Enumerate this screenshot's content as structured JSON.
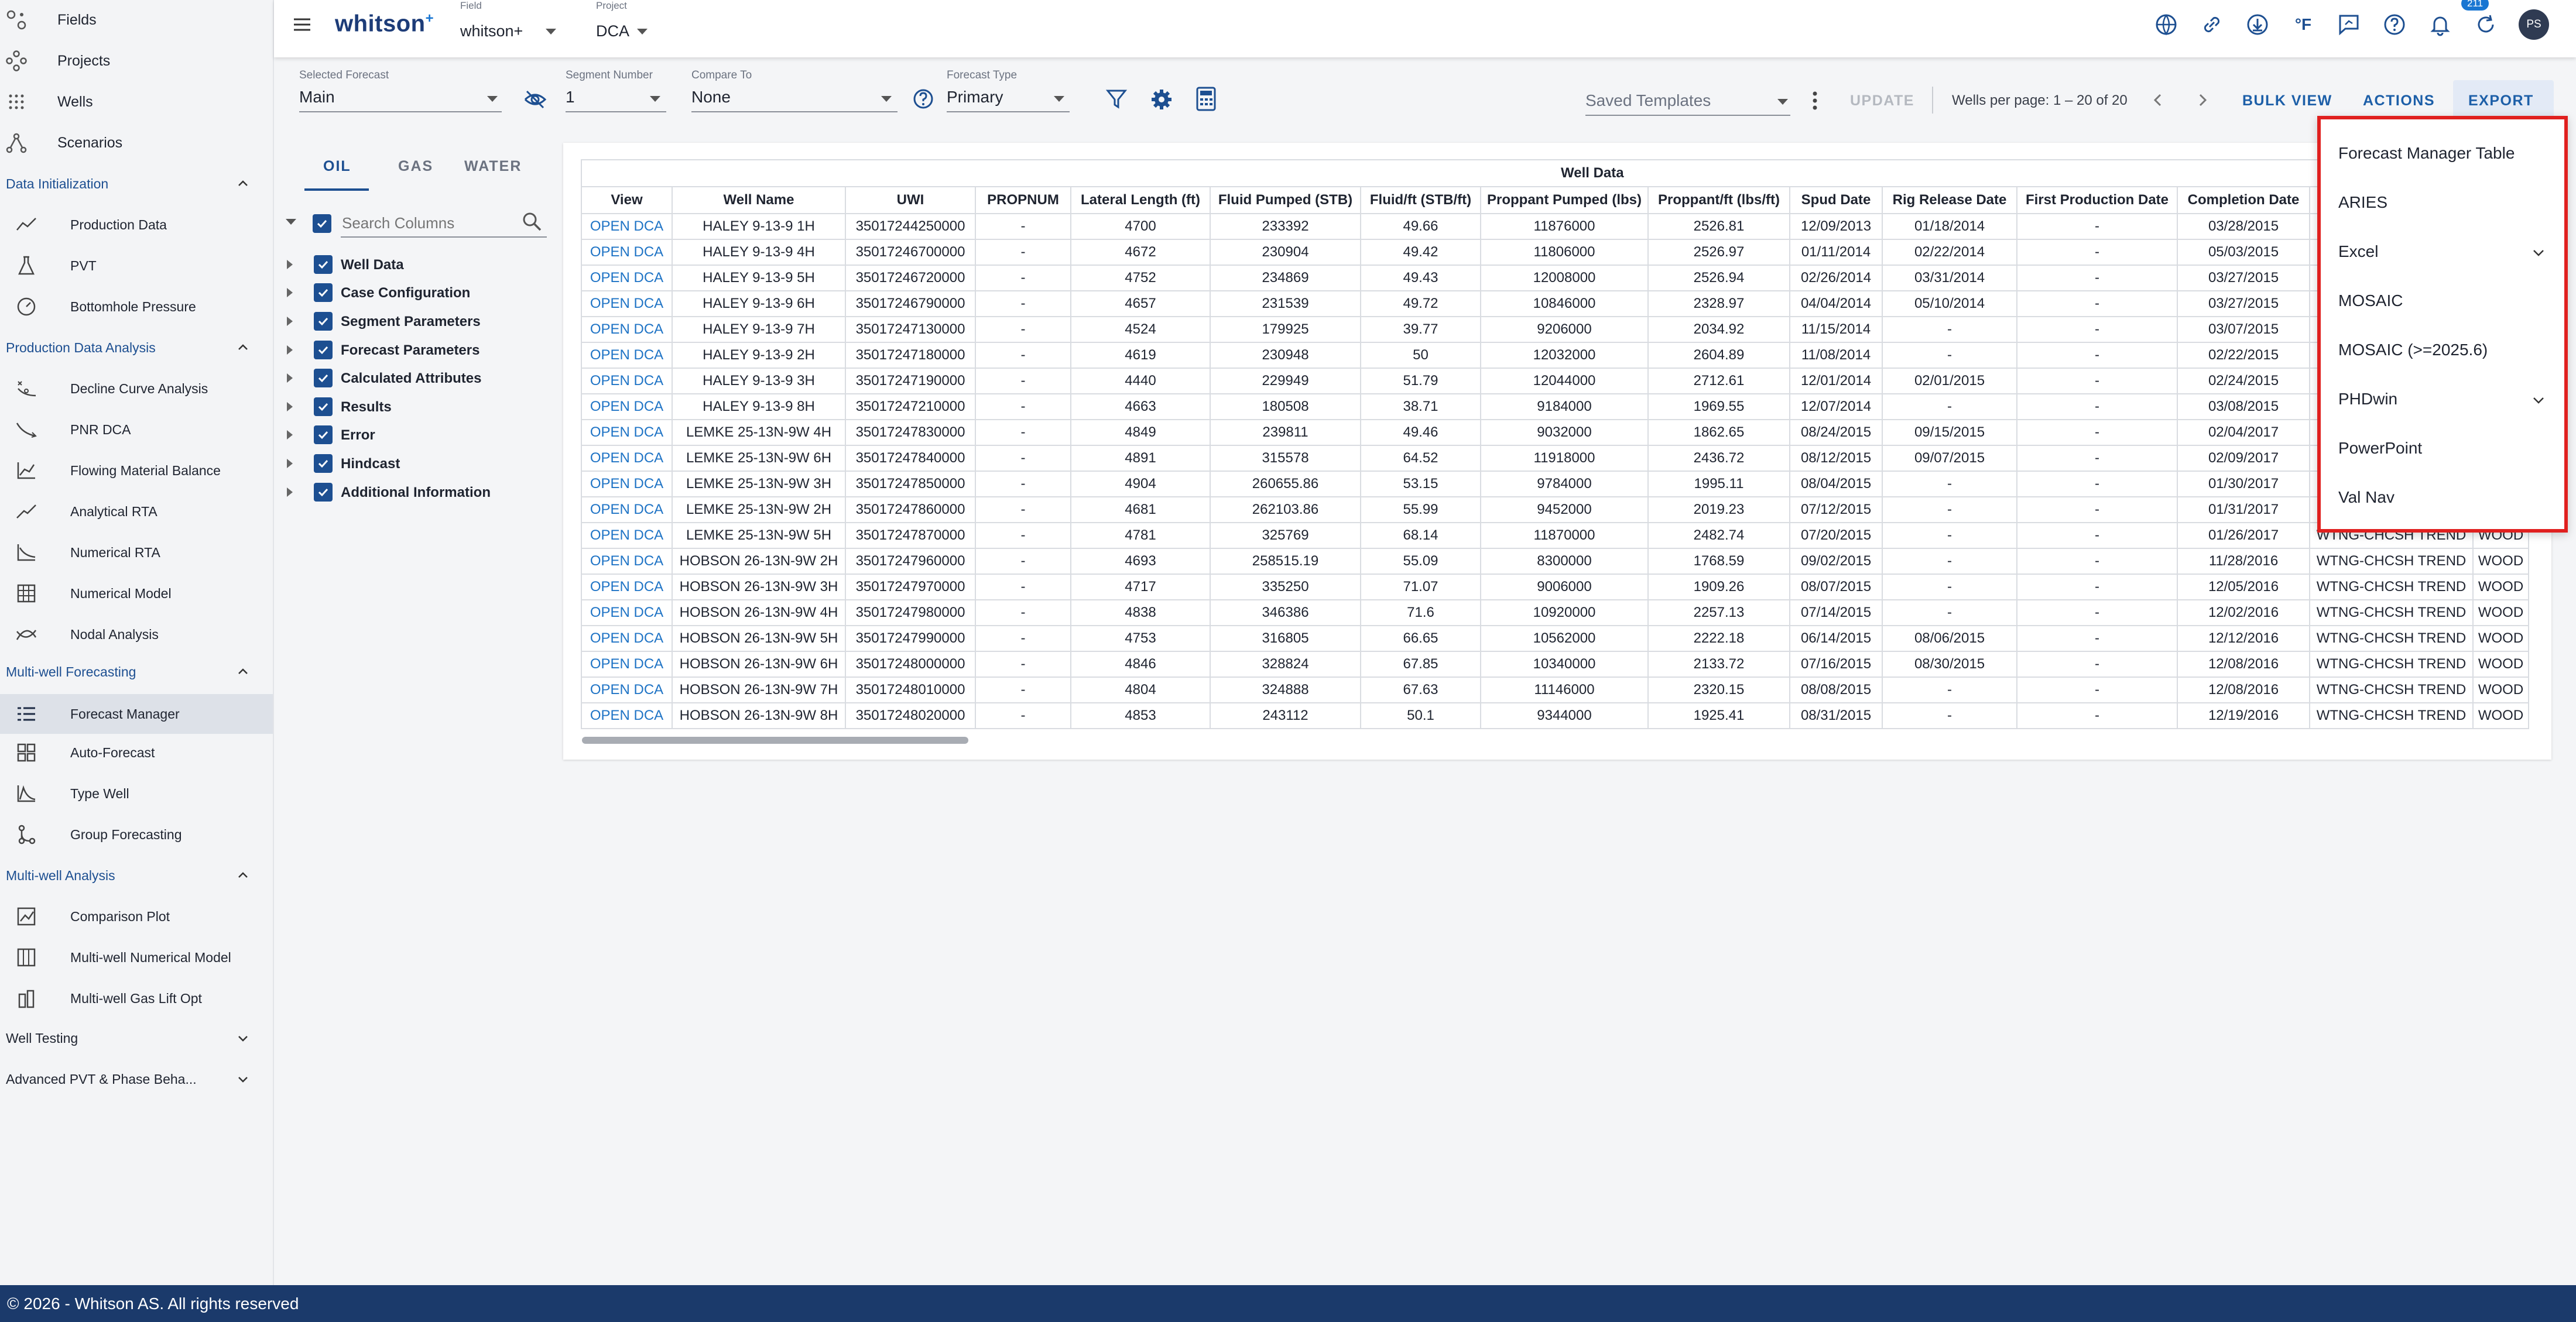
{
  "sidebar": {
    "top_items": [
      {
        "label": "Fields",
        "icon": "fields-icon"
      },
      {
        "label": "Projects",
        "icon": "projects-icon"
      },
      {
        "label": "Wells",
        "icon": "wells-icon"
      },
      {
        "label": "Scenarios",
        "icon": "scenarios-icon"
      }
    ],
    "sections": {
      "data_init": {
        "title": "Data Initialization",
        "items": [
          "Production Data",
          "PVT",
          "Bottomhole Pressure"
        ]
      },
      "prod_analysis": {
        "title": "Production Data Analysis",
        "items": [
          "Decline Curve Analysis",
          "PNR DCA",
          "Flowing Material Balance",
          "Analytical RTA",
          "Numerical RTA",
          "Numerical Model",
          "Nodal Analysis"
        ]
      },
      "mw_forecast": {
        "title": "Multi-well Forecasting",
        "items": [
          "Forecast Manager",
          "Auto-Forecast",
          "Type Well",
          "Group Forecasting"
        ]
      },
      "mw_analysis": {
        "title": "Multi-well Analysis",
        "items": [
          "Comparison Plot",
          "Multi-well Numerical Model",
          "Multi-well Gas Lift Opt"
        ]
      },
      "well_testing": {
        "title": "Well Testing"
      },
      "adv_pvt": {
        "title": "Advanced PVT & Phase Beha..."
      }
    }
  },
  "header": {
    "logo": "whitson",
    "logo_sup": "+",
    "field_label": "Field",
    "field_value": "whitson+",
    "project_label": "Project",
    "project_value": "DCA",
    "notifications_count": "211",
    "avatar": "PS",
    "temp_unit": "°F"
  },
  "toolbar": {
    "selected_forecast_label": "Selected Forecast",
    "selected_forecast_value": "Main",
    "segment_number_label": "Segment Number",
    "segment_number_value": "1",
    "compare_to_label": "Compare To",
    "compare_to_value": "None",
    "forecast_type_label": "Forecast Type",
    "forecast_type_value": "Primary",
    "saved_templates_placeholder": "Saved Templates",
    "update_label": "UPDATE",
    "pagination": "Wells per page: 1 – 20 of 20",
    "bulk_view_label": "BULK VIEW",
    "actions_label": "ACTIONS",
    "export_label": "EXPORT"
  },
  "column_panel": {
    "tabs": [
      "OIL",
      "GAS",
      "WATER"
    ],
    "search_placeholder": "Search Columns",
    "groups": [
      "Well Data",
      "Case Configuration",
      "Segment Parameters",
      "Forecast Parameters",
      "Calculated Attributes",
      "Results",
      "Error",
      "Hindcast",
      "Additional Information"
    ]
  },
  "table": {
    "group_header": "Well Data",
    "columns": [
      "View",
      "Well Name",
      "UWI",
      "PROPNUM",
      "Lateral Length (ft)",
      "Fluid Pumped (STB)",
      "Fluid/ft (STB/ft)",
      "Proppant Pumped (lbs)",
      "Proppant/ft (lbs/ft)",
      "Spud Date",
      "Rig Release Date",
      "First Production Date",
      "Completion Date",
      "",
      ""
    ],
    "rows": [
      [
        "OPEN DCA",
        "HALEY 9-13-9 1H",
        "35017244250000",
        "-",
        "4700",
        "233392",
        "49.66",
        "11876000",
        "2526.81",
        "12/09/2013",
        "01/18/2014",
        "-",
        "03/28/2015",
        "",
        ""
      ],
      [
        "OPEN DCA",
        "HALEY 9-13-9 4H",
        "35017246700000",
        "-",
        "4672",
        "230904",
        "49.42",
        "11806000",
        "2526.97",
        "01/11/2014",
        "02/22/2014",
        "-",
        "05/03/2015",
        "",
        ""
      ],
      [
        "OPEN DCA",
        "HALEY 9-13-9 5H",
        "35017246720000",
        "-",
        "4752",
        "234869",
        "49.43",
        "12008000",
        "2526.94",
        "02/26/2014",
        "03/31/2014",
        "-",
        "03/27/2015",
        "",
        ""
      ],
      [
        "OPEN DCA",
        "HALEY 9-13-9 6H",
        "35017246790000",
        "-",
        "4657",
        "231539",
        "49.72",
        "10846000",
        "2328.97",
        "04/04/2014",
        "05/10/2014",
        "-",
        "03/27/2015",
        "",
        ""
      ],
      [
        "OPEN DCA",
        "HALEY 9-13-9 7H",
        "35017247130000",
        "-",
        "4524",
        "179925",
        "39.77",
        "9206000",
        "2034.92",
        "11/15/2014",
        "-",
        "-",
        "03/07/2015",
        "",
        ""
      ],
      [
        "OPEN DCA",
        "HALEY 9-13-9 2H",
        "35017247180000",
        "-",
        "4619",
        "230948",
        "50",
        "12032000",
        "2604.89",
        "11/08/2014",
        "-",
        "-",
        "02/22/2015",
        "",
        ""
      ],
      [
        "OPEN DCA",
        "HALEY 9-13-9 3H",
        "35017247190000",
        "-",
        "4440",
        "229949",
        "51.79",
        "12044000",
        "2712.61",
        "12/01/2014",
        "02/01/2015",
        "-",
        "02/24/2015",
        "",
        ""
      ],
      [
        "OPEN DCA",
        "HALEY 9-13-9 8H",
        "35017247210000",
        "-",
        "4663",
        "180508",
        "38.71",
        "9184000",
        "1969.55",
        "12/07/2014",
        "-",
        "-",
        "03/08/2015",
        "",
        ""
      ],
      [
        "OPEN DCA",
        "LEMKE 25-13N-9W 4H",
        "35017247830000",
        "-",
        "4849",
        "239811",
        "49.46",
        "9032000",
        "1862.65",
        "08/24/2015",
        "09/15/2015",
        "-",
        "02/04/2017",
        "",
        ""
      ],
      [
        "OPEN DCA",
        "LEMKE 25-13N-9W 6H",
        "35017247840000",
        "-",
        "4891",
        "315578",
        "64.52",
        "11918000",
        "2436.72",
        "08/12/2015",
        "09/07/2015",
        "-",
        "02/09/2017",
        "",
        ""
      ],
      [
        "OPEN DCA",
        "LEMKE 25-13N-9W 3H",
        "35017247850000",
        "-",
        "4904",
        "260655.86",
        "53.15",
        "9784000",
        "1995.11",
        "08/04/2015",
        "-",
        "-",
        "01/30/2017",
        "",
        ""
      ],
      [
        "OPEN DCA",
        "LEMKE 25-13N-9W 2H",
        "35017247860000",
        "-",
        "4681",
        "262103.86",
        "55.99",
        "9452000",
        "2019.23",
        "07/12/2015",
        "-",
        "-",
        "01/31/2017",
        "",
        ""
      ],
      [
        "OPEN DCA",
        "LEMKE 25-13N-9W 5H",
        "35017247870000",
        "-",
        "4781",
        "325769",
        "68.14",
        "11870000",
        "2482.74",
        "07/20/2015",
        "-",
        "-",
        "01/26/2017",
        "WTNG-CHCSH TREND",
        "WOOD"
      ],
      [
        "OPEN DCA",
        "HOBSON 26-13N-9W 2H",
        "35017247960000",
        "-",
        "4693",
        "258515.19",
        "55.09",
        "8300000",
        "1768.59",
        "09/02/2015",
        "-",
        "-",
        "11/28/2016",
        "WTNG-CHCSH TREND",
        "WOOD"
      ],
      [
        "OPEN DCA",
        "HOBSON 26-13N-9W 3H",
        "35017247970000",
        "-",
        "4717",
        "335250",
        "71.07",
        "9006000",
        "1909.26",
        "08/07/2015",
        "-",
        "-",
        "12/05/2016",
        "WTNG-CHCSH TREND",
        "WOOD"
      ],
      [
        "OPEN DCA",
        "HOBSON 26-13N-9W 4H",
        "35017247980000",
        "-",
        "4838",
        "346386",
        "71.6",
        "10920000",
        "2257.13",
        "07/14/2015",
        "-",
        "-",
        "12/02/2016",
        "WTNG-CHCSH TREND",
        "WOOD"
      ],
      [
        "OPEN DCA",
        "HOBSON 26-13N-9W 5H",
        "35017247990000",
        "-",
        "4753",
        "316805",
        "66.65",
        "10562000",
        "2222.18",
        "06/14/2015",
        "08/06/2015",
        "-",
        "12/12/2016",
        "WTNG-CHCSH TREND",
        "WOOD"
      ],
      [
        "OPEN DCA",
        "HOBSON 26-13N-9W 6H",
        "35017248000000",
        "-",
        "4846",
        "328824",
        "67.85",
        "10340000",
        "2133.72",
        "07/16/2015",
        "08/30/2015",
        "-",
        "12/08/2016",
        "WTNG-CHCSH TREND",
        "WOOD"
      ],
      [
        "OPEN DCA",
        "HOBSON 26-13N-9W 7H",
        "35017248010000",
        "-",
        "4804",
        "324888",
        "67.63",
        "11146000",
        "2320.15",
        "08/08/2015",
        "-",
        "-",
        "12/08/2016",
        "WTNG-CHCSH TREND",
        "WOOD"
      ],
      [
        "OPEN DCA",
        "HOBSON 26-13N-9W 8H",
        "35017248020000",
        "-",
        "4853",
        "243112",
        "50.1",
        "9344000",
        "1925.41",
        "08/31/2015",
        "-",
        "-",
        "12/19/2016",
        "WTNG-CHCSH TREND",
        "WOOD"
      ]
    ]
  },
  "export_menu": {
    "items": [
      {
        "label": "Forecast Manager Table",
        "submenu": false
      },
      {
        "label": "ARIES",
        "submenu": false
      },
      {
        "label": "Excel",
        "submenu": true
      },
      {
        "label": "MOSAIC",
        "submenu": false
      },
      {
        "label": "MOSAIC (>=2025.6)",
        "submenu": false
      },
      {
        "label": "PHDwin",
        "submenu": true
      },
      {
        "label": "PowerPoint",
        "submenu": false
      },
      {
        "label": "Val Nav",
        "submenu": false
      }
    ]
  },
  "footer": {
    "text": "© 2026 - Whitson AS. All rights reserved"
  },
  "colors": {
    "brand_navy": "#1b3a6b",
    "accent_blue": "#1d4f91",
    "link_blue": "#1e73c5",
    "highlight_red": "#e0201f"
  }
}
